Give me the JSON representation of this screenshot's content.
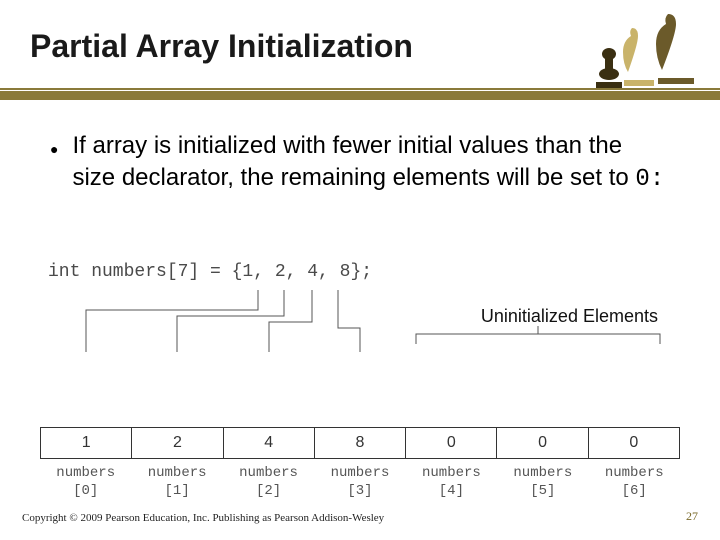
{
  "title": "Partial Array Initialization",
  "bullet": {
    "text_before_code": "If array is initialized with fewer initial values than the size declarator, the remaining elements will be set to ",
    "code_tail": "0:"
  },
  "diagram": {
    "code": "int numbers[7] = {1, 2, 4, 8};",
    "uninitialized_label": "Uninitialized Elements",
    "cells": [
      "1",
      "2",
      "4",
      "8",
      "0",
      "0",
      "0"
    ],
    "labels": [
      {
        "name": "numbers",
        "index": "[0]"
      },
      {
        "name": "numbers",
        "index": "[1]"
      },
      {
        "name": "numbers",
        "index": "[2]"
      },
      {
        "name": "numbers",
        "index": "[3]"
      },
      {
        "name": "numbers",
        "index": "[4]"
      },
      {
        "name": "numbers",
        "index": "[5]"
      },
      {
        "name": "numbers",
        "index": "[6]"
      }
    ]
  },
  "footer": {
    "copyright": "Copyright © 2009 Pearson Education, Inc. Publishing as Pearson Addison-Wesley",
    "page": "27"
  },
  "colors": {
    "rule": "#8a7a3a"
  }
}
